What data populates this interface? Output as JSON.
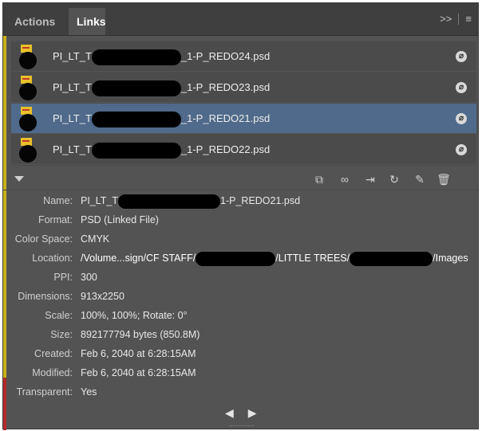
{
  "tabs": {
    "actions": "Actions",
    "links": "Links"
  },
  "tab_controls": {
    "expand": ">>",
    "menu": "≡"
  },
  "links": [
    {
      "prefix": "PI_LT_T",
      "suffix": "_1-P_REDO24.psd",
      "selected": false
    },
    {
      "prefix": "PI_LT_T",
      "suffix": "_1-P_REDO23.psd",
      "selected": false
    },
    {
      "prefix": "PI_LT_T",
      "suffix": "_1-P_REDO21.psd",
      "selected": true
    },
    {
      "prefix": "PI_LT_T",
      "suffix": "_1-P_REDO22.psd",
      "selected": false
    }
  ],
  "toolbar_icons": [
    "relink-from-cc-icon",
    "relink-icon",
    "go-to-link-icon",
    "update-link-icon",
    "edit-original-icon",
    "trash-icon"
  ],
  "info": {
    "name": {
      "label": "Name:",
      "prefix": "PI_LT_T",
      "suffix": "1-P_REDO21.psd"
    },
    "format": {
      "label": "Format:",
      "value": "PSD (Linked File)"
    },
    "color_space": {
      "label": "Color Space:",
      "value": "CMYK"
    },
    "location": {
      "label": "Location:",
      "part1": "/Volume...sign/CF STAFF/",
      "part2": "/LITTLE TREES/",
      "part3": "/Images"
    },
    "ppi": {
      "label": "PPI:",
      "value": "300"
    },
    "dimensions": {
      "label": "Dimensions:",
      "value": "913x2250"
    },
    "scale": {
      "label": "Scale:",
      "value": "100%, 100%; Rotate: 0°"
    },
    "size": {
      "label": "Size:",
      "value": "892177794 bytes (850.8M)"
    },
    "created": {
      "label": "Created:",
      "value": "Feb 6, 2040 at 6:28:15AM"
    },
    "modified": {
      "label": "Modified:",
      "value": "Feb 6, 2040 at 6:28:15AM"
    },
    "transparent": {
      "label": "Transparent:",
      "value": "Yes"
    }
  },
  "pager": {
    "prev": "◀",
    "next": "▶"
  },
  "colors": {
    "panel": "#535353",
    "selected_row": "#4f6a8a",
    "tabbar": "#3f3f3f"
  }
}
